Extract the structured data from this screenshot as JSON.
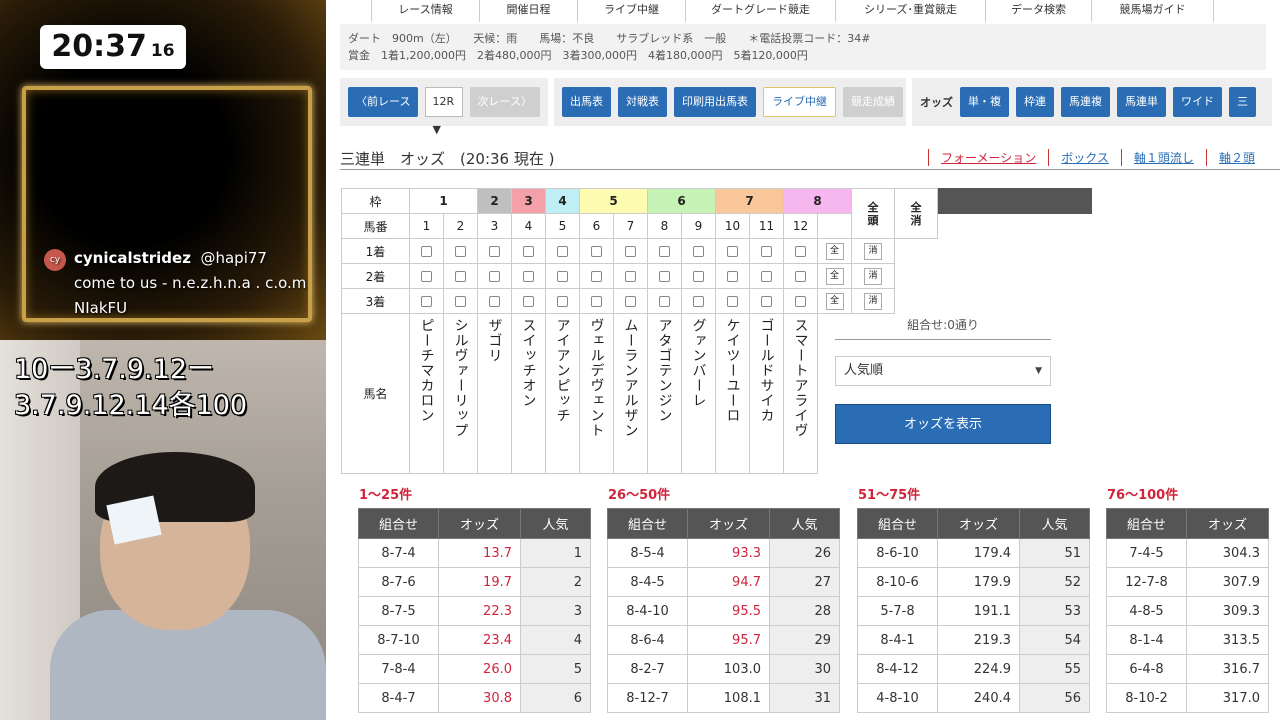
{
  "overlay": {
    "clock": {
      "hm": "20:37",
      "sec": "16"
    },
    "chat": {
      "avatar": "cy",
      "user": "cynicalstridez",
      "handle": "@hapi77",
      "message": "come to us - n.e.z.h.n.a . c.o.m NIakFU"
    },
    "caption": {
      "line1": "10ー3.7.9.12ー",
      "line2": "3.7.9.12.14各100"
    }
  },
  "nav": [
    "レース情報",
    "開催日程",
    "ライブ中継",
    "ダートグレード競走",
    "シリーズ･重賞競走",
    "データ検索",
    "競馬場ガイド"
  ],
  "race_info": {
    "line1": "ダート　900m（左）　　天候：雨　　馬場：不良　　サラブレッド系　一般　　＊電話投票コード：34#",
    "line2": "賞金　1着1,200,000円　2着480,000円　3着300,000円　4着180,000円　5着120,000円"
  },
  "controls": {
    "prev": "前レース",
    "race_select": "12R",
    "next": "次レース",
    "buttons": [
      "出馬表",
      "対戦表",
      "印刷用出馬表",
      "ライブ中継",
      "競走成績"
    ],
    "odds_label": "オッズ",
    "odds_buttons": [
      "単・複",
      "枠連",
      "馬連複",
      "馬連単",
      "ワイド",
      "三"
    ]
  },
  "section": {
    "title": "三連単　オッズ　(20:36 現在 )",
    "links": [
      "フォーメーション",
      "ボックス",
      "軸１頭流し",
      "軸２頭"
    ]
  },
  "selection": {
    "waku_label": "枠",
    "umaban_label": "馬番",
    "all_head": "全頭",
    "clear_head": "全消",
    "rows": [
      "1着",
      "2着",
      "3着"
    ],
    "all_btn": "全",
    "clear_btn": "消",
    "name_label": "馬名",
    "waku": [
      {
        "n": "1",
        "color": "#ffffff",
        "span": 2
      },
      {
        "n": "2",
        "color": "#bfbfbf",
        "span": 1
      },
      {
        "n": "3",
        "color": "#f4a0a8",
        "span": 1
      },
      {
        "n": "4",
        "color": "#bfeef4",
        "span": 1
      },
      {
        "n": "5",
        "color": "#fdfcb0",
        "span": 2
      },
      {
        "n": "6",
        "color": "#c6f2b6",
        "span": 2
      },
      {
        "n": "7",
        "color": "#f9c79a",
        "span": 2
      },
      {
        "n": "8",
        "color": "#f6b6ee",
        "span": 2
      }
    ],
    "umaban": [
      "1",
      "2",
      "3",
      "4",
      "5",
      "6",
      "7",
      "8",
      "9",
      "10",
      "11",
      "12"
    ],
    "horses": [
      "ピーチマカロン",
      "シルヴァーリップ",
      "ザゴリ",
      "スイッチオン",
      "アイアンピッチ",
      "ヴェルデヴェント",
      "ムーランアルザン",
      "アタゴテンジン",
      "グァンバーレ",
      "ケイツーユーロ",
      "ゴールドサイカ",
      "スマートアライヴ"
    ],
    "combo_count": "組合せ:0通り",
    "sort_value": "人気順",
    "show_button": "オッズを表示"
  },
  "odds_tables": [
    {
      "range": "1〜25件",
      "cols": [
        "組合せ",
        "オッズ",
        "人気"
      ],
      "rows": [
        [
          "8-7-4",
          "13.7",
          "1"
        ],
        [
          "8-7-6",
          "19.7",
          "2"
        ],
        [
          "8-7-5",
          "22.3",
          "3"
        ],
        [
          "8-7-10",
          "23.4",
          "4"
        ],
        [
          "7-8-4",
          "26.0",
          "5"
        ],
        [
          "8-4-7",
          "30.8",
          "6"
        ]
      ]
    },
    {
      "range": "26〜50件",
      "cols": [
        "組合せ",
        "オッズ",
        "人気"
      ],
      "rows": [
        [
          "8-5-4",
          "93.3",
          "26"
        ],
        [
          "8-4-5",
          "94.7",
          "27"
        ],
        [
          "8-4-10",
          "95.5",
          "28"
        ],
        [
          "8-6-4",
          "95.7",
          "29"
        ],
        [
          "8-2-7",
          "103.0",
          "30"
        ],
        [
          "8-12-7",
          "108.1",
          "31"
        ]
      ]
    },
    {
      "range": "51〜75件",
      "cols": [
        "組合せ",
        "オッズ",
        "人気"
      ],
      "rows": [
        [
          "8-6-10",
          "179.4",
          "51"
        ],
        [
          "8-10-6",
          "179.9",
          "52"
        ],
        [
          "5-7-8",
          "191.1",
          "53"
        ],
        [
          "8-4-1",
          "219.3",
          "54"
        ],
        [
          "8-4-12",
          "224.9",
          "55"
        ],
        [
          "4-8-10",
          "240.4",
          "56"
        ]
      ]
    },
    {
      "range": "76〜100件",
      "cols": [
        "組合せ",
        "オッズ"
      ],
      "rows": [
        [
          "7-4-5",
          "304.3"
        ],
        [
          "12-7-8",
          "307.9"
        ],
        [
          "4-8-5",
          "309.3"
        ],
        [
          "8-1-4",
          "313.5"
        ],
        [
          "6-4-8",
          "316.7"
        ],
        [
          "8-10-2",
          "317.0"
        ]
      ]
    }
  ],
  "colors": {
    "accent": "#2a6db5",
    "red": "#d0243c",
    "header_dark": "#555555"
  }
}
